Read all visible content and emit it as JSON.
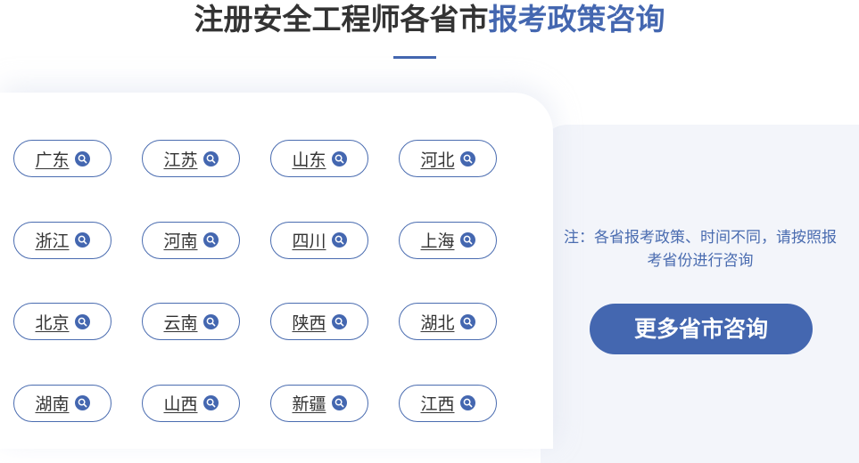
{
  "header": {
    "title_main": "注册安全工程师各省市",
    "title_accent": "报考政策咨询"
  },
  "provinces": [
    "广东",
    "江苏",
    "山东",
    "河北",
    "浙江",
    "河南",
    "四川",
    "上海",
    "北京",
    "云南",
    "陕西",
    "湖北",
    "湖南",
    "山西",
    "新疆",
    "江西"
  ],
  "sidebar": {
    "note": "注：各省报考政策、时间不同，请按照报考省份进行咨询",
    "more_button": "更多省市咨询"
  },
  "colors": {
    "accent": "#4467b0",
    "title_text": "#333333",
    "panel_bg": "#f3f5fa"
  },
  "icons": {
    "pill_icon": "search-icon"
  }
}
